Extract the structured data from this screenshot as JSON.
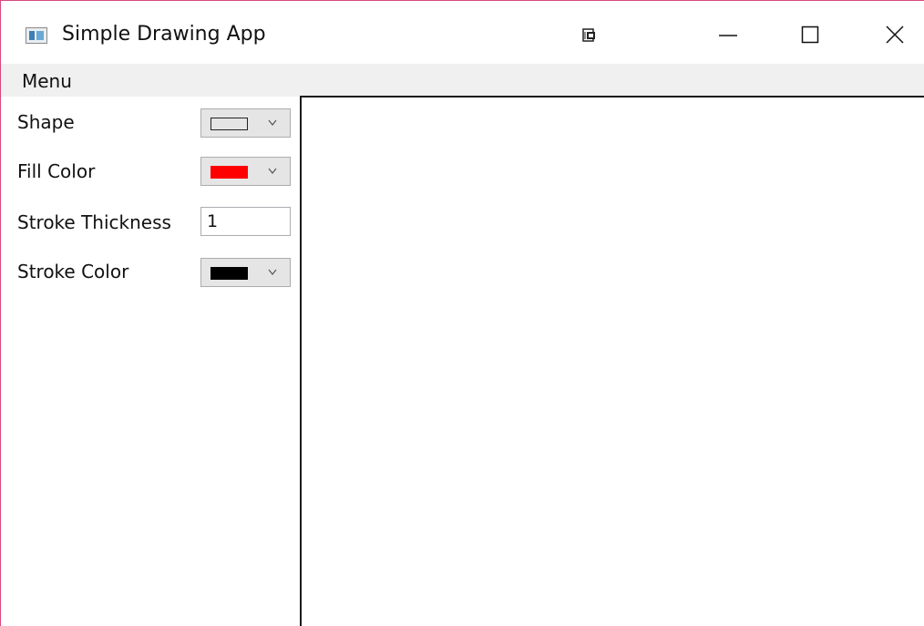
{
  "window": {
    "title": "Simple Drawing App",
    "icon": "app-window-icon",
    "controls": [
      "snap-icon",
      "minimize-icon",
      "maximize-icon",
      "close-icon"
    ]
  },
  "menu": {
    "items": [
      {
        "label": "Menu"
      }
    ]
  },
  "panel": {
    "shape": {
      "label": "Shape",
      "selected_icon": "rectangle-outline-icon"
    },
    "fill_color": {
      "label": "Fill Color",
      "value_color": "#ff0000"
    },
    "stroke_thickness": {
      "label": "Stroke Thickness",
      "value": "1"
    },
    "stroke_color": {
      "label": "Stroke Color",
      "value_color": "#000000"
    }
  },
  "colors": {
    "window_border": "#d9477f",
    "menubar_bg": "#f0f0f0",
    "combo_bg": "#e5e5e5",
    "canvas_border": "#1a1a1a"
  }
}
